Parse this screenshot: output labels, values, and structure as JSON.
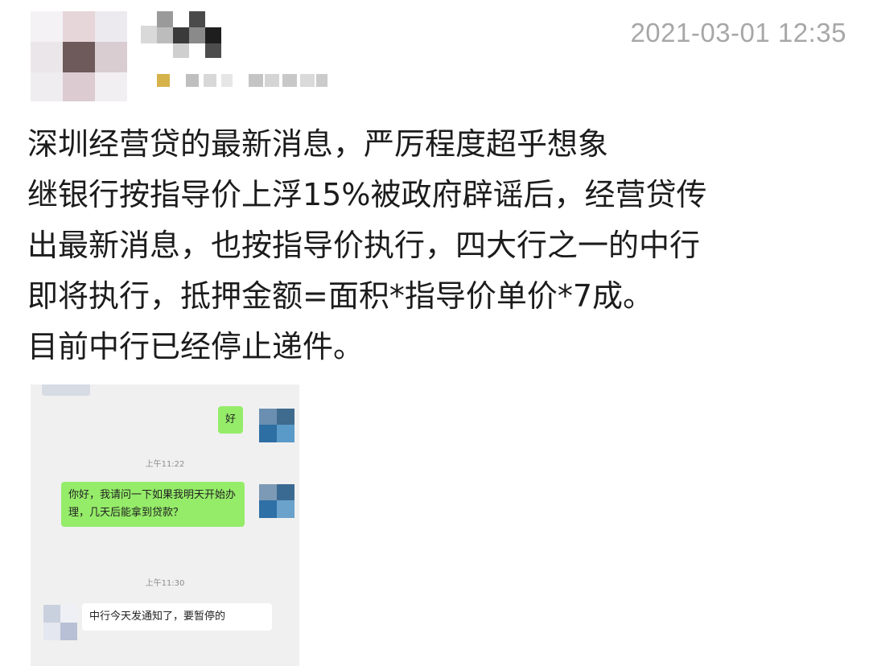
{
  "header": {
    "timestamp": "2021-03-01 12:35"
  },
  "post": {
    "lines": [
      "深圳经营贷的最新消息，严厉程度超乎想象",
      "继银行按指导价上浮15%被政府辟谣后，经营贷传",
      "出最新消息，也按指导价执行，四大行之一的中行",
      "即将执行，抵押金额=面积*指导价单价*7成。",
      "目前中行已经停止递件。"
    ]
  },
  "chat": {
    "messages": [
      {
        "side": "right",
        "text": "好"
      },
      {
        "side": "right",
        "text": "你好，我请问一下如果我明天开始办理，几天后能拿到贷款？"
      },
      {
        "side": "left",
        "text": "中行今天发通知了，要暂停的"
      }
    ],
    "times": [
      "上午11:22",
      "上午11:30"
    ]
  },
  "colors": {
    "sent_bubble": "#95ec69",
    "received_bubble": "#ffffff",
    "chat_background": "#f0f0f0",
    "timestamp_text": "#a7a7a7"
  }
}
